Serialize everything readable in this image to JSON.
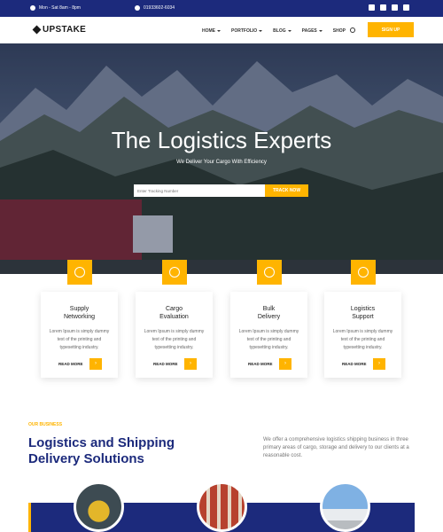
{
  "topbar": {
    "hours": "Mon - Sat 8am - 8pm",
    "phone": "01933602-6034",
    "social_icons": [
      "facebook-icon",
      "twitter-icon",
      "instagram-icon",
      "youtube-icon"
    ]
  },
  "header": {
    "logo": "UPSTAKE",
    "menu": [
      "HOME",
      "PORTFOLIO",
      "BLOG",
      "PAGES",
      "SHOP"
    ],
    "signup": "SIGN UP"
  },
  "hero": {
    "title": "The Logistics Experts",
    "subtitle": "We Deliver Your Cargo With Efficiency",
    "track_placeholder": "Enter Tracking Number",
    "track_button": "TRACK NOW"
  },
  "services": [
    {
      "title_line1": "Supply",
      "title_line2": "Networking",
      "body": "Lorem Ipsum is simply dummy text of the printing and typesetting industry.",
      "more": "READ MORE"
    },
    {
      "title_line1": "Cargo",
      "title_line2": "Evaluation",
      "body": "Lorem Ipsum is simply dummy text of the printing and typesetting industry.",
      "more": "READ MORE"
    },
    {
      "title_line1": "Bulk",
      "title_line2": "Delivery",
      "body": "Lorem Ipsum is simply dummy text of the printing and typesetting industry.",
      "more": "READ MORE"
    },
    {
      "title_line1": "Logistics",
      "title_line2": "Support",
      "body": "Lorem Ipsum is simply dummy text of the printing and typesetting industry.",
      "more": "READ MORE"
    }
  ],
  "business": {
    "eyebrow": "OUR BUSINESS",
    "headline_line1": "Logistics and Shipping",
    "headline_line2": "Delivery Solutions",
    "blurb": "We offer a comprehensive logistics shipping business in three primary areas of cargo, storage and delivery to our clients at a reasonable cost."
  },
  "colors": {
    "primary": "#1c2a7c",
    "accent": "#ffb400"
  }
}
